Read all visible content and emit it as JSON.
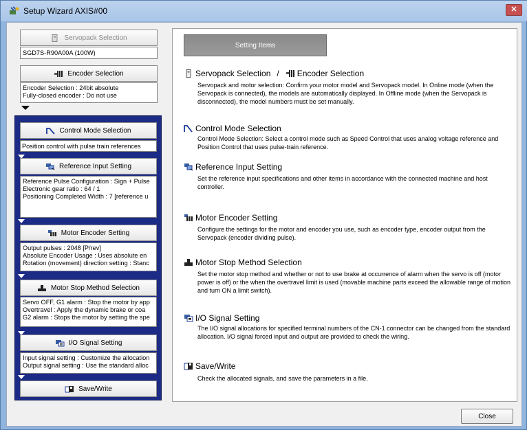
{
  "window": {
    "title": "Setup Wizard AXIS#00",
    "close_glyph": "✕"
  },
  "left": {
    "servopack_button": "Servopack Selection",
    "servopack_model": "SGD7S-R90A00A (100W)",
    "encoder_button": "Encoder Selection",
    "encoder_info": [
      "Encoder Selection : 24bit absolute",
      "Fully-closed encoder : Do not use"
    ],
    "control_mode_button": "Control Mode Selection",
    "control_mode_info": [
      "Position control with pulse train references"
    ],
    "reference_button": "Reference Input Setting",
    "reference_info": [
      "Reference Pulse Configuration : Sign + Pulse",
      "Electronic gear ratio : 64 / 1",
      "Positioning Completed Width : 7 [reference u"
    ],
    "motor_encoder_button": "Motor Encoder Setting",
    "motor_encoder_info": [
      "Output pulses : 2048 [P/rev]",
      "Absolute Encoder Usage : Uses absolute en",
      "Rotation (movement) direction setting : Stanc"
    ],
    "motor_stop_button": "Motor Stop Method Selection",
    "motor_stop_info": [
      "Servo OFF, G1 alarm : Stop the motor by app",
      "Overtravel : Apply the dynamic brake or coa",
      "G2 alarm : Stops the motor by setting the spe"
    ],
    "io_button": "I/O Signal Setting",
    "io_info": [
      "Input signal setting : Customize the allocation",
      "Output signal setting : Use the standard alloc"
    ],
    "save_button": "Save/Write"
  },
  "right": {
    "header_button": "Setting Items",
    "sections": [
      {
        "title_a": "Servopack Selection",
        "separator": "/",
        "title_b": "Encoder Selection",
        "desc": "Servopack and motor selection: Confirm your motor model and Servopack model. In Online mode (when the Servopack is connected), the models are automatically displayed. In Offline mode (when the Servopack is disconnected), the model numbers must be set manually."
      },
      {
        "title": "Control Mode Selection",
        "desc": "Control Mode Selection: Select a control mode such as Speed Control that uses analog voltage reference and Position Control that uses pulse-train reference."
      },
      {
        "title": "Reference Input Setting",
        "desc": "Set the reference input specifications and other items in accordance with the connected machine and host controller."
      },
      {
        "title": "Motor Encoder Setting",
        "desc": "Configure the settings for the motor and encoder you use, such as encoder type, encoder output from the Servopack (encoder dividing pulse)."
      },
      {
        "title": "Motor Stop Method Selection",
        "desc": "Set the motor stop method and whether or not to use brake at occurrence of alarm when the servo is off (motor power is off) or the when the overtravel limit is used (movable machine parts exceed the allowable range of motion and turn ON a limit switch)."
      },
      {
        "title": "I/O Signal Setting",
        "desc": "The I/O signal allocations for specified terminal numbers of the CN-1 connector can be changed from the standard allocation. I/O signal forced input and output are provided to check the wiring."
      },
      {
        "title": "Save/Write",
        "desc": "Check the allocated signals, and save the parameters in a file."
      }
    ]
  },
  "footer": {
    "close_button": "Close"
  },
  "colors": {
    "panel_blue": "#1c2b86",
    "title_bar": "#bcd3ee",
    "close_red": "#c75050"
  }
}
